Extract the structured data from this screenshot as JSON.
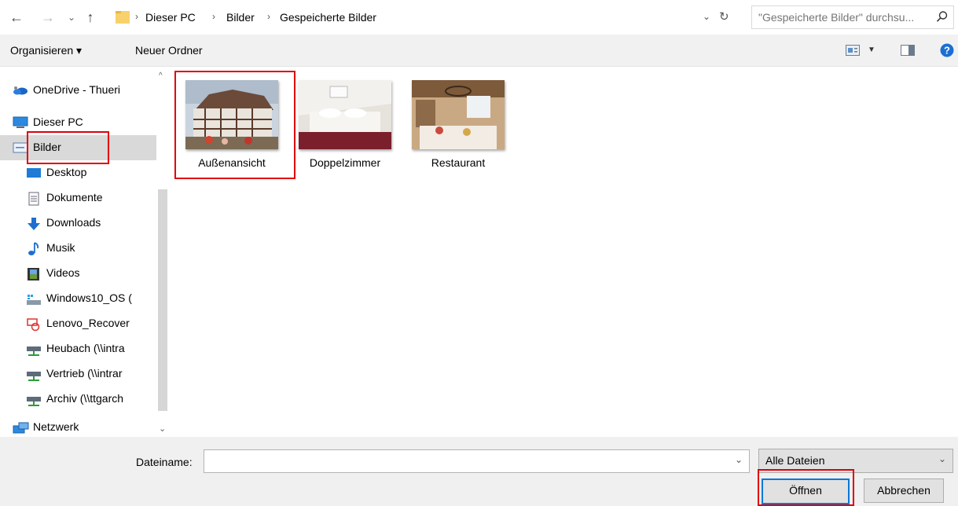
{
  "address": {
    "breadcrumb": [
      "Dieser PC",
      "Bilder",
      "Gespeicherte Bilder"
    ],
    "search_placeholder": "\"Gespeicherte Bilder\" durchsu..."
  },
  "toolbar": {
    "organize_label": "Organisieren ▾",
    "new_folder_label": "Neuer Ordner"
  },
  "sidebar": {
    "items": [
      {
        "label": "OneDrive - Thueri",
        "icon": "onedrive-icon"
      },
      {
        "label": "Dieser PC",
        "icon": "computer-icon"
      },
      {
        "label": "Bilder",
        "icon": "pictures-icon",
        "selected": true
      },
      {
        "label": "Desktop",
        "icon": "desktop-icon"
      },
      {
        "label": "Dokumente",
        "icon": "documents-icon"
      },
      {
        "label": "Downloads",
        "icon": "downloads-icon"
      },
      {
        "label": "Musik",
        "icon": "music-icon"
      },
      {
        "label": "Videos",
        "icon": "videos-icon"
      },
      {
        "label": "Windows10_OS (",
        "icon": "drive-icon"
      },
      {
        "label": "Lenovo_Recover",
        "icon": "recovery-drive-icon"
      },
      {
        "label": "Heubach (\\\\intra",
        "icon": "network-drive-icon"
      },
      {
        "label": "Vertrieb (\\\\intrar",
        "icon": "network-drive-icon"
      },
      {
        "label": "Archiv (\\\\ttgarch",
        "icon": "network-drive-icon"
      },
      {
        "label": "Netzwerk",
        "icon": "network-icon"
      }
    ]
  },
  "files": [
    {
      "name": "Außenansicht"
    },
    {
      "name": "Doppelzimmer"
    },
    {
      "name": "Restaurant"
    }
  ],
  "bottom": {
    "filename_label": "Dateiname:",
    "filename_value": "",
    "filetype_value": "Alle Dateien",
    "open_label": "Öffnen",
    "cancel_label": "Abbrechen"
  },
  "colors": {
    "highlight": "#e0000a",
    "selection": "#d9d9d9",
    "accent": "#0078d7"
  }
}
